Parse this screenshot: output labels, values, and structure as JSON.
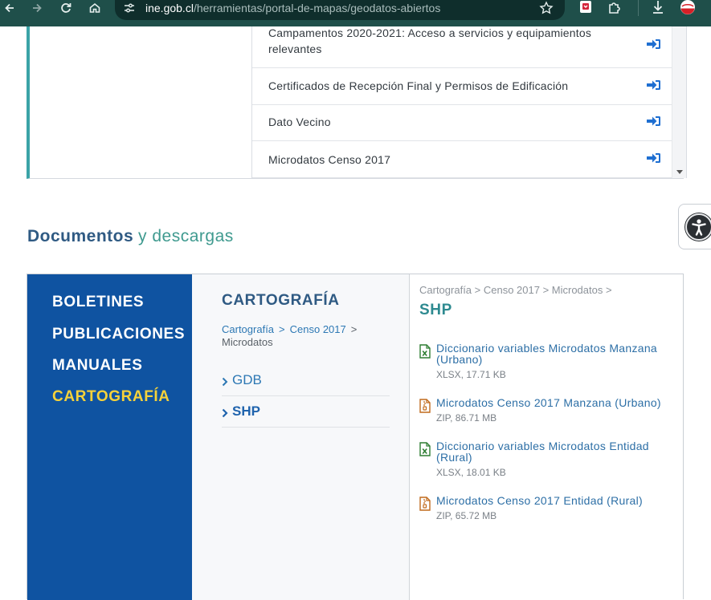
{
  "browser": {
    "url_host": "ine.gob.cl",
    "url_path": "/herramientas/portal-de-mapas/geodatos-abiertos",
    "icons": [
      "back-arrow-icon",
      "forward-arrow-icon",
      "reload-icon",
      "home-icon",
      "site-settings-icon",
      "bookmark-star-icon",
      "extension-icon",
      "extensions-puzzle-icon",
      "download-icon",
      "profile-icon"
    ]
  },
  "dataset_list": {
    "items": [
      {
        "label": "Campamentos 2020-2021: Acceso a servicios y equipamientos relevantes",
        "icon": "sign-in-icon"
      },
      {
        "label": "Certificados de Recepción Final y Permisos de Edificación",
        "icon": "sign-in-icon"
      },
      {
        "label": "Dato Vecino",
        "icon": "sign-in-icon"
      },
      {
        "label": "Microdatos Censo 2017",
        "icon": "sign-in-icon"
      }
    ]
  },
  "section": {
    "heading_strong": "Documentos",
    "heading_light": "y descargas"
  },
  "categories": {
    "items": [
      {
        "label": "BOLETINES",
        "active": false
      },
      {
        "label": "PUBLICACIONES",
        "active": false
      },
      {
        "label": "MANUALES",
        "active": false
      },
      {
        "label": "CARTOGRAFÍA",
        "active": true
      }
    ]
  },
  "middle": {
    "title": "CARTOGRAFÍA",
    "breadcrumb": {
      "part1": "Cartografía",
      "sep": ">",
      "part2": "Censo 2017",
      "part3": "Microdatos"
    },
    "subitems": [
      {
        "label": "GDB",
        "active": false
      },
      {
        "label": "SHP",
        "active": true
      }
    ]
  },
  "files": {
    "breadcrumb": "Cartografía > Censo 2017 > Microdatos >",
    "title": "SHP",
    "items": [
      {
        "name": "Diccionario variables Microdatos Manzana (Urbano)",
        "meta": "XLSX, 17.71 KB",
        "icon": "excel-file-icon"
      },
      {
        "name": "Microdatos Censo 2017 Manzana (Urbano)",
        "meta": "ZIP, 86.71 MB",
        "icon": "zip-file-icon"
      },
      {
        "name": "Diccionario variables Microdatos Entidad (Rural)",
        "meta": "XLSX, 18.01 KB",
        "icon": "excel-file-icon"
      },
      {
        "name": "Microdatos Censo 2017 Entidad (Rural)",
        "meta": "ZIP, 65.72 MB",
        "icon": "zip-file-icon"
      }
    ]
  },
  "colors": {
    "category_sidebar": "#0f53a1",
    "active_category": "#f6d23a",
    "link": "#2d78b4",
    "accent_teal": "#3ba3a7"
  }
}
